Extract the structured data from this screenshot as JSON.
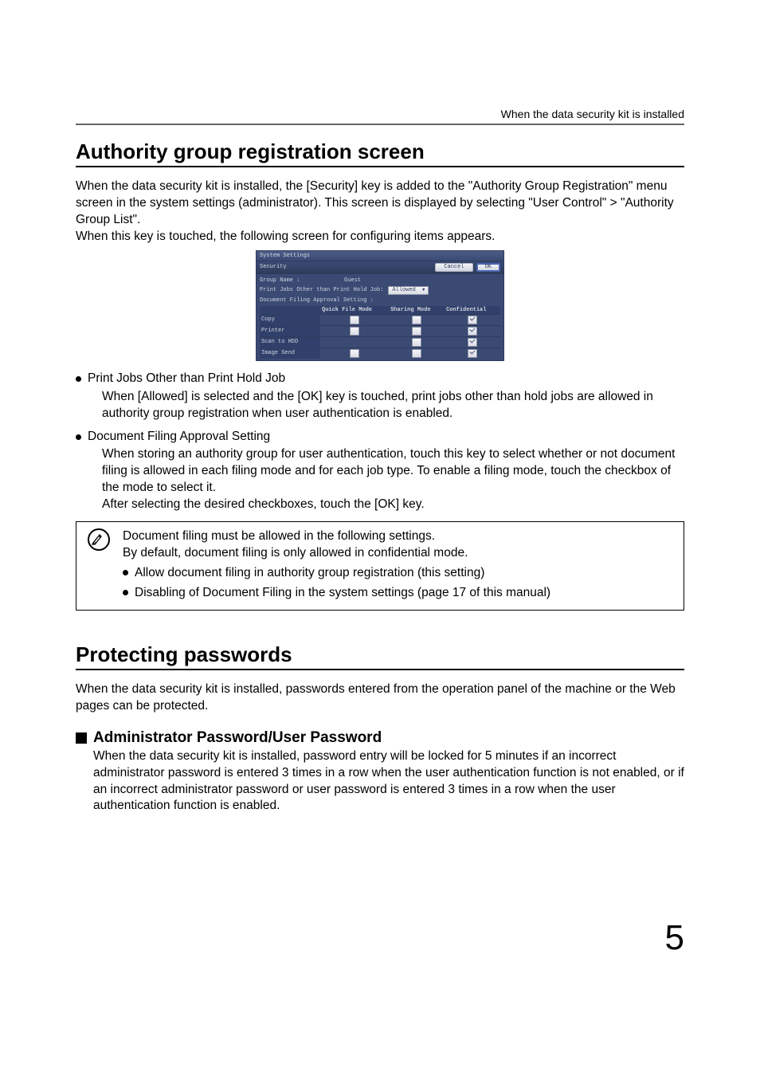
{
  "header_note": "When the data security kit is installed",
  "section1": {
    "title": "Authority group registration screen",
    "intro1": "When the data security kit is installed, the [Security] key is added to the \"Authority Group Registration\" menu screen in the system settings (administrator). This screen is displayed by selecting \"User Control\" > \"Authority Group List\".",
    "intro2": "When this key is touched, the following screen for configuring items appears."
  },
  "ui": {
    "titlebar": "System Settings",
    "tab": "Security",
    "cancel": "Cancel",
    "ok": "OK",
    "group_name_label": "Group Name :",
    "group_name_value": "Guest",
    "print_jobs_label": "Print Jobs Other than Print Hold Job:",
    "print_jobs_value": "Allowed",
    "approval_label": "Document Filing Approval Setting :",
    "table": {
      "headers": [
        "",
        "Quick File Mode",
        "Sharing Mode",
        "Confidential"
      ],
      "rows": [
        {
          "name": "Copy",
          "quick": false,
          "share": false,
          "conf": true
        },
        {
          "name": "Printer",
          "quick": false,
          "share": false,
          "conf": true
        },
        {
          "name": "Scan to HDD",
          "quick": null,
          "share": false,
          "conf": true
        },
        {
          "name": "Image Send",
          "quick": false,
          "share": false,
          "conf": true
        }
      ]
    }
  },
  "bullets": [
    {
      "title": "Print Jobs Other than Print Hold Job",
      "body": "When [Allowed] is selected and the [OK] key is touched, print jobs other than hold jobs are allowed in authority group registration when user authentication is enabled."
    },
    {
      "title": "Document Filing Approval Setting",
      "body": "When storing an authority group for user authentication, touch this key to select whether or not document filing is allowed in each filing mode and for each job type. To enable a filing mode, touch the checkbox of the mode to select it.\nAfter selecting the desired checkboxes, touch the [OK] key."
    }
  ],
  "note": {
    "line1": "Document filing must be allowed in the following settings.",
    "line2": "By default, document filing is only allowed in confidential mode.",
    "sub1": "Allow document filing in authority group registration (this setting)",
    "sub2": "Disabling of Document Filing in the system settings (page 17 of this manual)"
  },
  "section2": {
    "title": "Protecting passwords",
    "intro": "When the data security kit is installed, passwords entered from the operation panel of the machine or the Web pages can be protected.",
    "sub_title": "Administrator Password/User Password",
    "sub_body": "When the data security kit is installed, password entry will be locked for 5 minutes if an incorrect administrator password is entered 3 times in a row when the user authentication function is not enabled, or if an incorrect administrator password or user password is entered 3 times in a row when the user authentication function is enabled."
  },
  "page_number": "5"
}
